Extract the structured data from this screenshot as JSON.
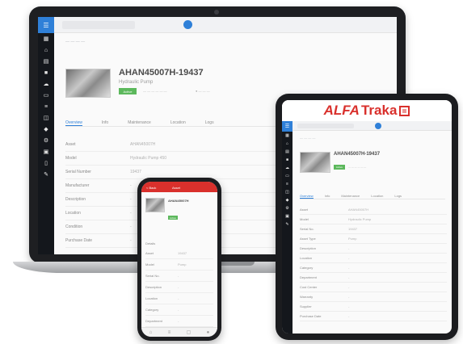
{
  "laptop": {
    "sidebar_icons": [
      "grid-icon",
      "home-icon",
      "calendar-icon",
      "square-icon",
      "cloud-icon",
      "document-icon",
      "list-icon",
      "cart-icon",
      "tag-icon",
      "gear-icon",
      "box-icon",
      "clipboard-icon",
      "wrench-icon"
    ],
    "asset_title": "AHAN45007H-19437",
    "asset_subtitle": "Hydraulic Pump",
    "status_badge": "Active",
    "tabs": [
      "Overview",
      "Info",
      "Maintenance",
      "Location",
      "Logs"
    ],
    "details": [
      {
        "label": "Asset",
        "value": "AHAN45007H"
      },
      {
        "label": "Model",
        "value": "Hydraulic Pump 450"
      },
      {
        "label": "Serial Number",
        "value": "19437"
      },
      {
        "label": "Manufacturer",
        "value": "-"
      },
      {
        "label": "Description",
        "value": "-"
      },
      {
        "label": "Location",
        "value": "-"
      },
      {
        "label": "Condition",
        "value": "-"
      },
      {
        "label": "Purchase Date",
        "value": "-"
      }
    ]
  },
  "tablet": {
    "brand_alfa": "ALFA",
    "brand_traka": "Traka",
    "sidebar_icons": [
      "grid-icon",
      "home-icon",
      "calendar-icon",
      "square-icon",
      "cloud-icon",
      "document-icon",
      "list-icon",
      "cart-icon",
      "tag-icon",
      "gear-icon",
      "box-icon",
      "wrench-icon"
    ],
    "asset_title": "AHAN45007H-19437",
    "status_badge": "Active",
    "tabs": [
      "Overview",
      "Info",
      "Maintenance",
      "Location",
      "Logs"
    ],
    "details": [
      {
        "label": "Asset",
        "value": "AHAN45007H"
      },
      {
        "label": "Model",
        "value": "Hydraulic Pump"
      },
      {
        "label": "Serial No.",
        "value": "19437"
      },
      {
        "label": "Asset Type",
        "value": "Pump"
      },
      {
        "label": "Description",
        "value": "-"
      },
      {
        "label": "Location",
        "value": "-"
      },
      {
        "label": "Category",
        "value": "-"
      },
      {
        "label": "Department",
        "value": "-"
      },
      {
        "label": "Cost Center",
        "value": "-"
      },
      {
        "label": "Warranty",
        "value": "-"
      },
      {
        "label": "Supplier",
        "value": "-"
      },
      {
        "label": "Purchase Date",
        "value": "-"
      }
    ]
  },
  "phone": {
    "back_label": "< Back",
    "header_title": "Asset",
    "asset_title": "AHAN45007H",
    "status_badge": "Active",
    "section_label": "Details",
    "details": [
      {
        "label": "Asset",
        "value": "19437"
      },
      {
        "label": "Model",
        "value": "Pump"
      },
      {
        "label": "Serial No.",
        "value": "-"
      },
      {
        "label": "Description",
        "value": "-"
      },
      {
        "label": "Location",
        "value": "-"
      },
      {
        "label": "Category",
        "value": "-"
      },
      {
        "label": "Department",
        "value": "-"
      }
    ],
    "tabbar_icons": [
      "home-icon",
      "list-icon",
      "scan-icon",
      "user-icon"
    ]
  },
  "colors": {
    "accent_blue": "#2f80d8",
    "brand_red": "#d9302c",
    "status_green": "#5cb85c",
    "sidebar_dark": "#14171c"
  }
}
